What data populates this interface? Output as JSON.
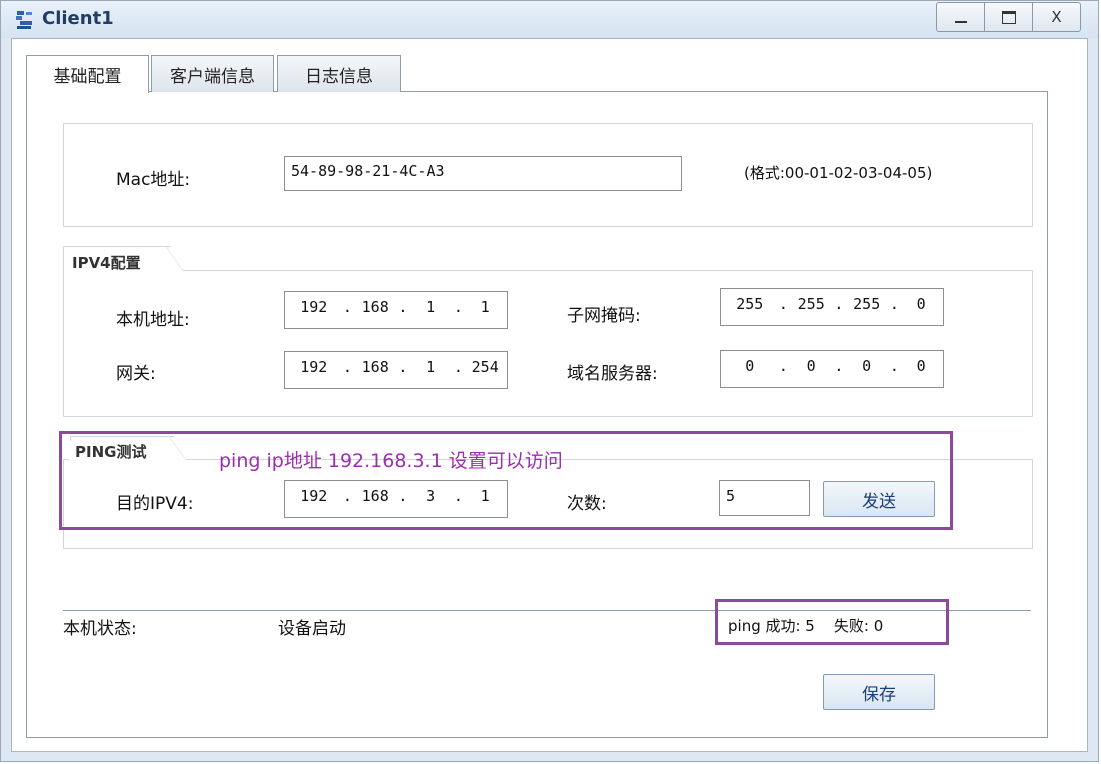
{
  "window": {
    "title": "Client1",
    "min": "—",
    "max": "☐",
    "close": "X"
  },
  "tabs": [
    {
      "label": "基础配置",
      "active": true
    },
    {
      "label": "客户端信息",
      "active": false
    },
    {
      "label": "日志信息",
      "active": false
    }
  ],
  "mac": {
    "label": "Mac地址:",
    "value": "54-89-98-21-4C-A3",
    "hint": "(格式:00-01-02-03-04-05)"
  },
  "ipv4": {
    "legend": "IPV4配置",
    "local_label": "本机地址:",
    "local": [
      "192",
      "168",
      "1",
      "1"
    ],
    "mask_label": "子网掩码:",
    "mask": [
      "255",
      "255",
      "255",
      "0"
    ],
    "gateway_label": "网关:",
    "gateway": [
      "192",
      "168",
      "1",
      "254"
    ],
    "dns_label": "域名服务器:",
    "dns": [
      "0",
      "0",
      "0",
      "0"
    ]
  },
  "ping": {
    "legend": "PING测试",
    "annotation": "ping ip地址 192.168.3.1 设置可以访问",
    "target_label": "目的IPV4:",
    "target": [
      "192",
      "168",
      "3",
      "1"
    ],
    "count_label": "次数:",
    "count": "5",
    "send_label": "发送"
  },
  "status": {
    "label": "本机状态:",
    "value": "设备启动",
    "ping_result": "ping 成功: 5    失败: 0"
  },
  "save_label": "保存",
  "colors": {
    "highlight": "#8b4a9c",
    "annotation": "#9b2fae",
    "button_text": "#1c3f78"
  }
}
